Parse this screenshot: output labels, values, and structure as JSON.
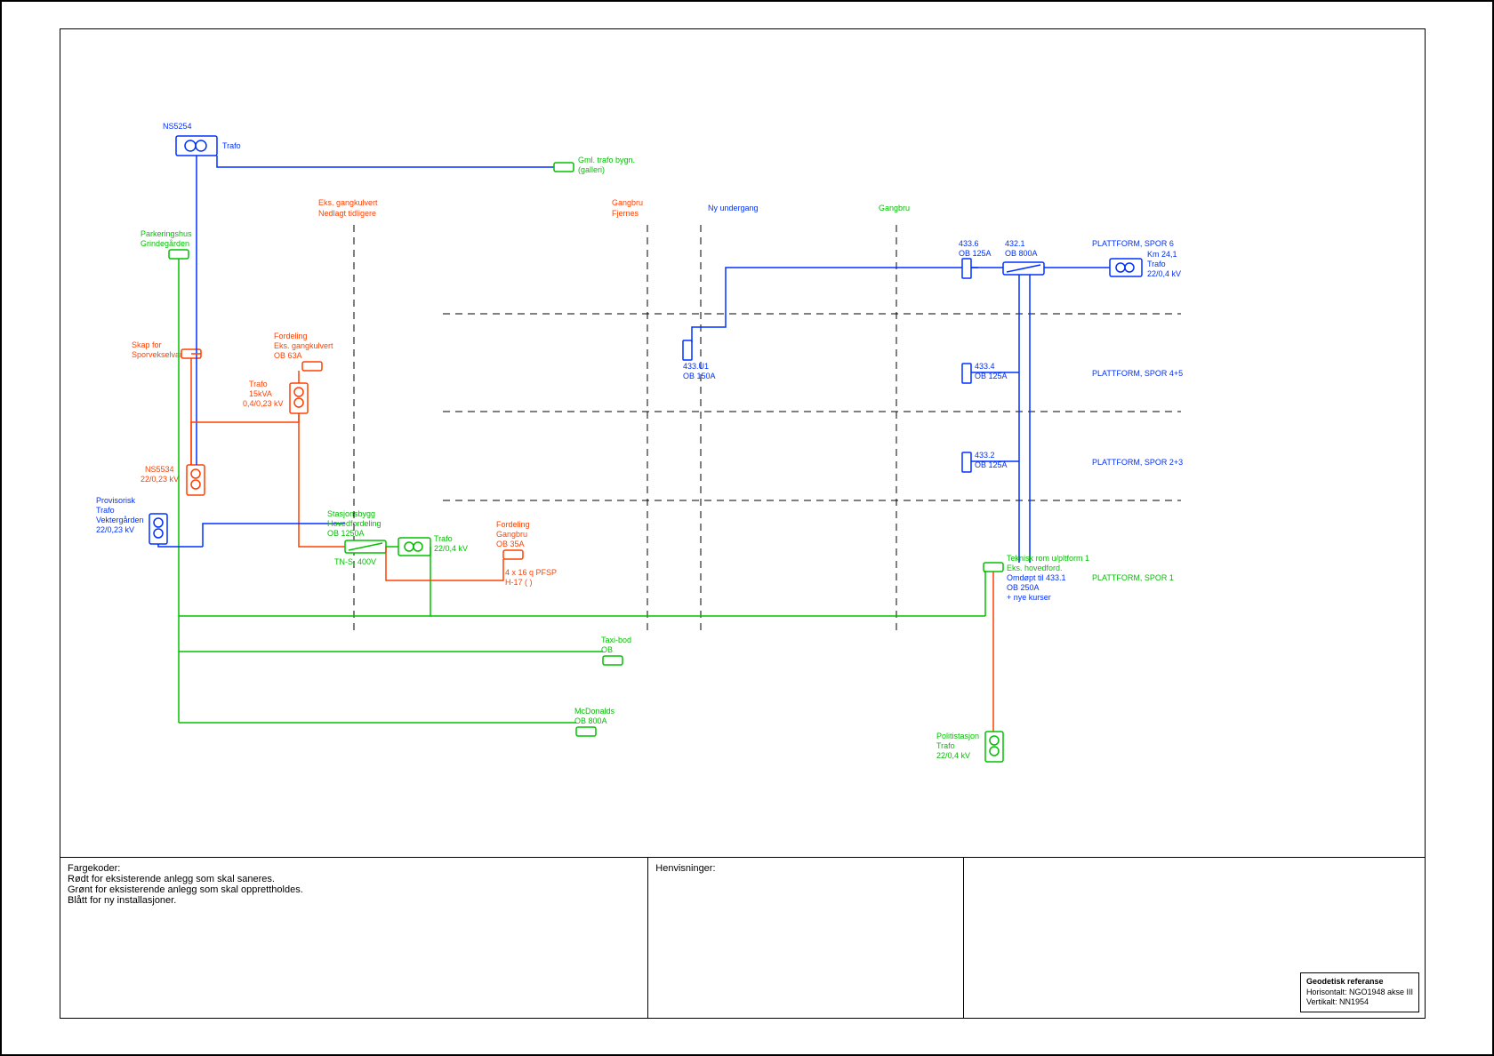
{
  "title_ns": "NS5254",
  "trafo_label": "Trafo",
  "gml_trafo": "Gml. trafo bygn.\n(galleri)",
  "eks_gang1": "Eks. gangkulvert",
  "eks_gang2": "Nedlagt tidligere",
  "gangbru_fj1": "Gangbru",
  "gangbru_fj2": "Fjernes",
  "ny_undergang": "Ny undergang",
  "gangbru_right": "Gangbru",
  "parkeringshus1": "Parkeringshus",
  "parkeringshus2": "Grindegården",
  "skap1": "Skap for",
  "skap2": "Sporvekselvarme",
  "fordeling_eks1": "Fordeling",
  "fordeling_eks2": "Eks. gangkulvert",
  "fordeling_eks3": "OB 63A",
  "trafo15_1": "Trafo",
  "trafo15_2": "15kVA",
  "trafo15_3": "0,4/0,23 kV",
  "ns5534_1": "NS5534",
  "ns5534_2": "22/0,23 kV",
  "prov1": "Provisorisk",
  "prov2": "Trafo",
  "prov3": "Vektergården",
  "prov4": "22/0,23 kV",
  "stasj1": "Stasjonsbygg",
  "stasj2": "Hovedfordeling",
  "stasj3": "OB 1250A",
  "tns": "TN-S, 400V",
  "trafo22": "Trafo\n22/0,4 kV",
  "ford_gb1": "Fordeling",
  "ford_gb2": "Gangbru",
  "ford_gb3": "OB 35A",
  "pfsp1": "4 x 16 q PFSP",
  "pfsp2": "H-17 (     )",
  "n433u1_1": "433.U1",
  "n433u1_2": "OB 150A",
  "n4336_1": "433.6",
  "n4336_2": "OB 125A",
  "n4321_1": "432.1",
  "n4321_2": "OB 800A",
  "n4334_1": "433.4",
  "n4334_2": "OB 125A",
  "n4332_1": "433.2",
  "n4332_2": "OB 125A",
  "km1": "Km 24,1",
  "km2": "Trafo",
  "km3": "22/0,4 kV",
  "platt6": "PLATTFORM, SPOR 6",
  "platt45": "PLATTFORM, SPOR 4+5",
  "platt23": "PLATTFORM, SPOR 2+3",
  "platt1": "PLATTFORM, SPOR 1",
  "tekn1": "Teknisk rom u/pltform 1",
  "tekn2": "Eks. hovedford.",
  "tekn3": "Omdøpt til 433.1",
  "tekn4": "OB 250A",
  "tekn5": "+ nye kurser",
  "taxi1": "Taxi-bod",
  "taxi2": "OB",
  "mcd1": "McDonalds",
  "mcd2": "OB 800A",
  "politi1": "Politistasjon",
  "politi2": "Trafo",
  "politi3": "22/0,4 kV",
  "fargekoder_h": "Fargekoder:",
  "fargekoder_1": "Rødt for eksisterende anlegg som skal saneres.",
  "fargekoder_2": "Grønt for eksisterende anlegg som skal opprettholdes.",
  "fargekoder_3": "Blått for ny installasjoner.",
  "henvisninger": "Henvisninger:",
  "geo1": "Geodetisk referanse",
  "geo2": "Horisontalt: NGO1948 akse III",
  "geo3": "Vertikalt:    NN1954"
}
